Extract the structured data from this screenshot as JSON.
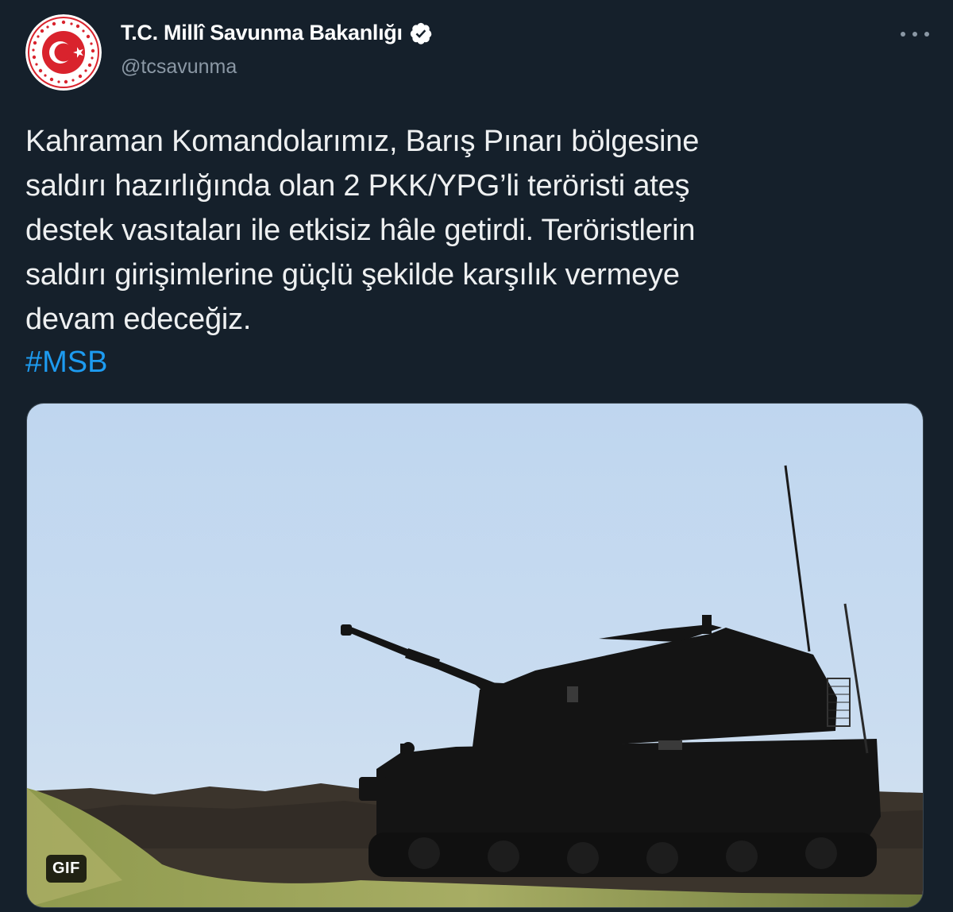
{
  "author": {
    "display_name": "T.C. Millî Savunma Bakanlığı",
    "handle": "@tcsavunma",
    "verified": true
  },
  "tweet": {
    "text_lines": [
      "Kahraman Komandolarımız, Barış Pınarı bölgesine",
      "saldırı hazırlığında olan 2 PKK/YPG’li teröristi ateş",
      "destek vasıtaları ile etkisiz hâle getirdi. Teröristlerin",
      "saldırı girişimlerine güçlü şekilde karşılık vermeye",
      "devam edeceğiz."
    ],
    "hashtag": "#MSB"
  },
  "media": {
    "type": "gif",
    "badge_label": "GIF"
  },
  "icons": {
    "avatar": "ministry-emblem-icon",
    "verified": "verified-badge-icon",
    "more": "more-options-icon"
  },
  "colors": {
    "background": "#15202b",
    "text": "#e7e9ea",
    "secondary_text": "#8b98a5",
    "link": "#1d9bf0",
    "emblem_red": "#d9232d"
  }
}
